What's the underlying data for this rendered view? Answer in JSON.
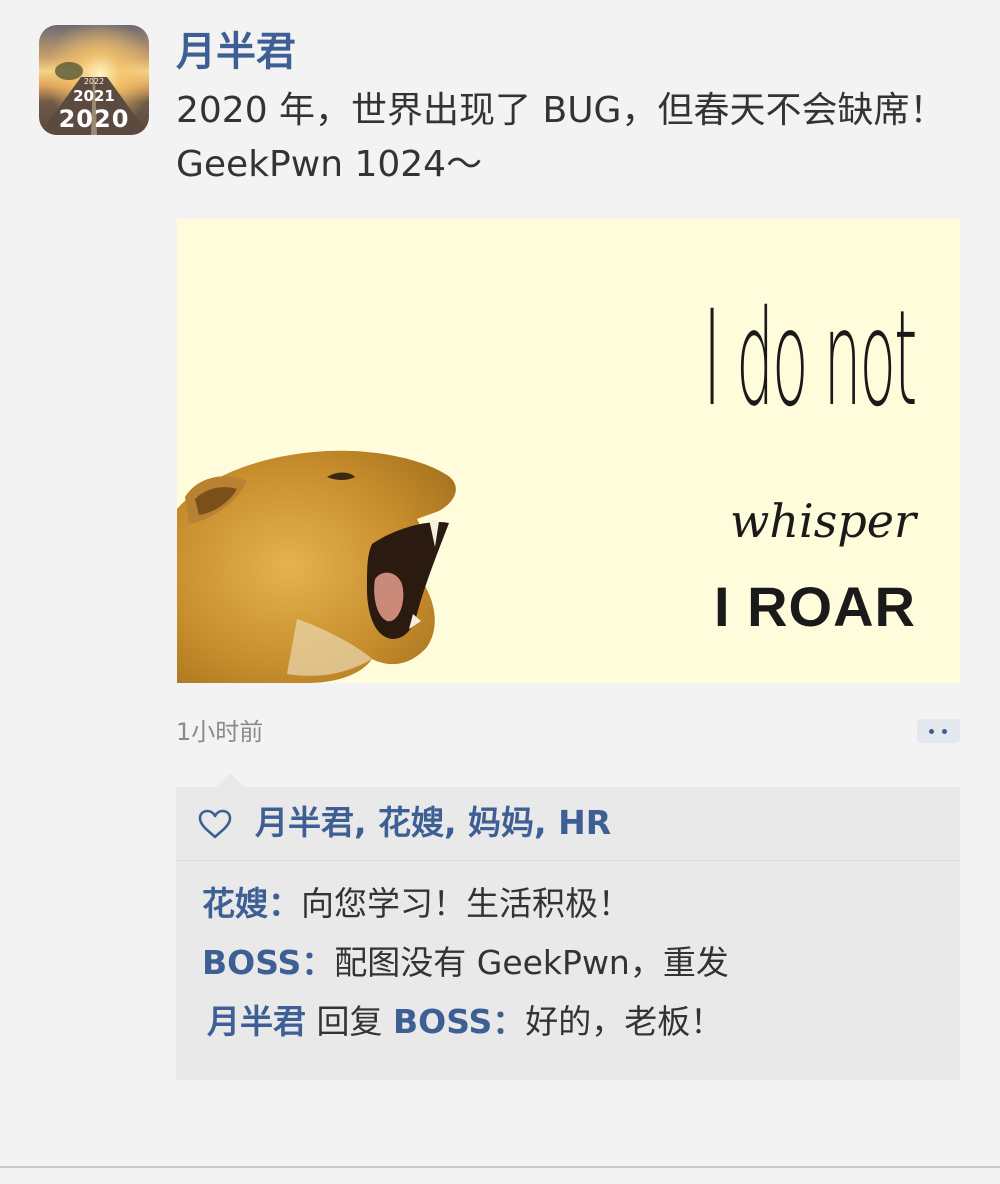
{
  "post": {
    "author": "月半君",
    "text": "2020 年，世界出现了 BUG，但春天不会缺席！GeekPwn 1024～",
    "avatar": {
      "year_large": "2020",
      "year_mid": "2021",
      "year_small": "2022"
    },
    "image": {
      "line1": "I do not",
      "line2": "whisper",
      "line3": "I ROAR"
    },
    "time": "1小时前"
  },
  "likes": {
    "icon": "heart-outline-icon",
    "names": "月半君, 花嫂, 妈妈, HR"
  },
  "comments": [
    {
      "author": "花嫂",
      "separator": "：",
      "text": "向您学习！生活积极！"
    },
    {
      "author": "BOSS",
      "separator": "：",
      "text": "配图没有 GeekPwn，重发"
    },
    {
      "author": "月半君",
      "reply_word": " 回复 ",
      "reply_to": "BOSS",
      "separator": "：",
      "text": "好的，老板！"
    }
  ],
  "colors": {
    "link": "#3d5f94",
    "text": "#333333",
    "background": "#f3f3f3",
    "comment_bg": "#e9e9e9",
    "image_bg": "#fffcdb"
  }
}
